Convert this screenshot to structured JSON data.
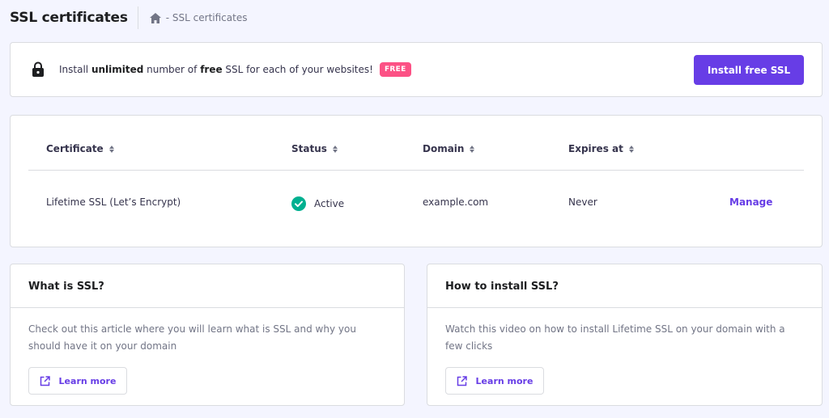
{
  "header": {
    "title": "SSL certificates",
    "breadcrumb": "- SSL certificates"
  },
  "banner": {
    "text_1": "Install ",
    "text_bold_1": "unlimited",
    "text_2": " number of ",
    "text_bold_2": "free",
    "text_3": " SSL for each of your websites!",
    "badge": "FREE",
    "button": "Install free SSL"
  },
  "table": {
    "columns": [
      "Certificate",
      "Status",
      "Domain",
      "Expires at"
    ],
    "rows": [
      {
        "certificate": "Lifetime SSL (Let’s Encrypt)",
        "status": "Active",
        "domain": "example.com",
        "expires": "Never",
        "action": "Manage"
      }
    ]
  },
  "info": [
    {
      "title": "What is SSL?",
      "description": "Check out this article where you will learn what is SSL and why you should have it on your domain",
      "button": "Learn more"
    },
    {
      "title": "How to install SSL?",
      "description": "Watch this video on how to install Lifetime SSL on your domain with a few clicks",
      "button": "Learn more"
    }
  ],
  "colors": {
    "accent": "#673de6",
    "badge": "#fc5185",
    "success": "#00b090",
    "background": "#f4f5ff"
  },
  "icons": [
    "home-icon",
    "lock-icon",
    "sort-icon",
    "check-circle-icon",
    "external-link-icon"
  ]
}
